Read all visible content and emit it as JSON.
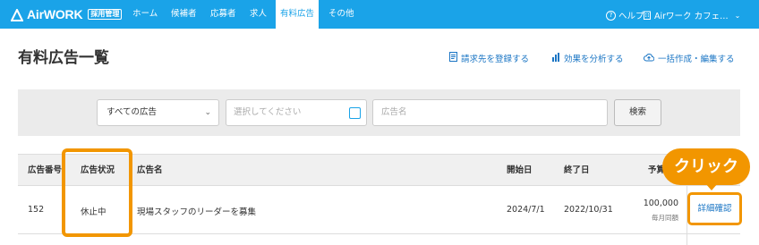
{
  "app": {
    "logo_text": "AirWORK",
    "logo_badge": "採用管理"
  },
  "nav": {
    "items": [
      {
        "label": "ホーム"
      },
      {
        "label": "候補者"
      },
      {
        "label": "応募者"
      },
      {
        "label": "求人"
      },
      {
        "label": "有料広告"
      },
      {
        "label": "その他"
      }
    ],
    "active_index": 4,
    "help_label": "ヘルプ",
    "account_label": "Airワーク カフェ…"
  },
  "page": {
    "title": "有料広告一覧",
    "actions": [
      {
        "label": "請求先を登録する",
        "icon": "document-icon"
      },
      {
        "label": "効果を分析する",
        "icon": "bar-chart-icon"
      },
      {
        "label": "一括作成・編集する",
        "icon": "cloud-upload-icon"
      }
    ]
  },
  "filters": {
    "ad_type_value": "すべての広告",
    "date_placeholder": "選択してください",
    "ad_name_placeholder": "広告名",
    "search_label": "検索"
  },
  "table": {
    "headers": {
      "ad_number": "広告番号",
      "status": "広告状況",
      "ad_name": "広告名",
      "start_date": "開始日",
      "end_date": "終了日",
      "budget": "予算"
    },
    "rows": [
      {
        "ad_number": "152",
        "status": "休止中",
        "ad_name": "現場スタッフのリーダーを募集",
        "start_date": "2024/7/1",
        "end_date": "2022/10/31",
        "budget": "100,000",
        "budget_note": "毎月同額",
        "detail_label": "詳細確認"
      }
    ]
  },
  "annotation": {
    "callout_text": "クリック",
    "color": "#f29600"
  },
  "colors": {
    "brand": "#1aa3e8",
    "link": "#1a75c4"
  }
}
